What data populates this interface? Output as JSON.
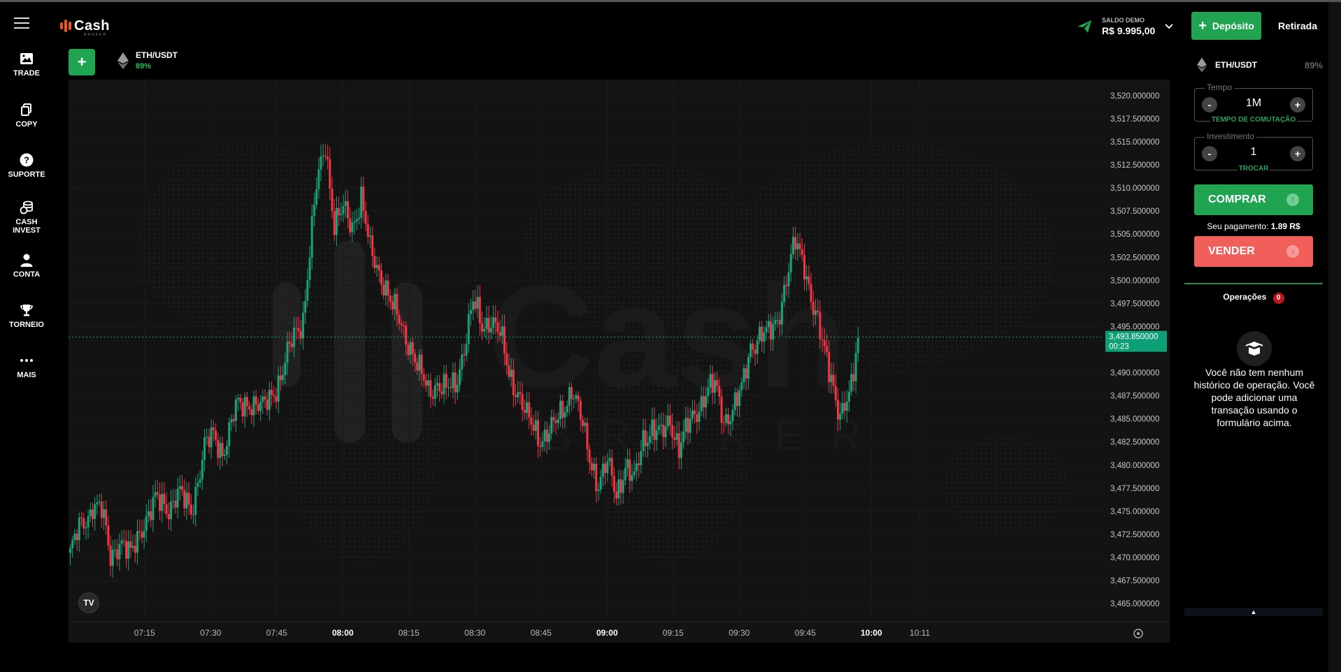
{
  "app": {
    "logo_text": "Cash",
    "logo_sub": "BROKER"
  },
  "sidebar": {
    "items": [
      {
        "label": "TRADE",
        "icon": "image-icon"
      },
      {
        "label": "COPY",
        "icon": "copy-icon"
      },
      {
        "label": "SUPORTE",
        "icon": "help-icon"
      },
      {
        "label": "CASH",
        "label2": "INVEST",
        "icon": "coins-icon"
      },
      {
        "label": "CONTA",
        "icon": "user-icon"
      },
      {
        "label": "TORNEIO",
        "icon": "trophy-icon"
      },
      {
        "label": "MAIS",
        "icon": "more-icon"
      }
    ]
  },
  "toolbar": {
    "add_label": "+",
    "more_label": "..."
  },
  "asset_tab": {
    "name": "ETH/USDT",
    "payout": "89%"
  },
  "header": {
    "balance_caption": "SALDO DEMO",
    "balance_value": "R$ 9.995,00",
    "deposit_label": "Depósito",
    "deposit_plus": "+",
    "withdraw_label": "Retirada"
  },
  "chart": {
    "current_price": "3,493.850000",
    "countdown": "00:23",
    "watermark": "Cash",
    "watermark_sub": "BROKER",
    "tv_label": "TV"
  },
  "chart_data": {
    "type": "candlestick",
    "y_ticks": [
      "3,520.000000",
      "3,517.500000",
      "3,515.000000",
      "3,512.500000",
      "3,510.000000",
      "3,507.500000",
      "3,505.000000",
      "3,502.500000",
      "3,500.000000",
      "3,497.500000",
      "3,495.000000",
      "3,490.000000",
      "3,487.500000",
      "3,485.000000",
      "3,482.500000",
      "3,480.000000",
      "3,477.500000",
      "3,475.000000",
      "3,472.500000",
      "3,470.000000",
      "3,467.500000",
      "3,465.000000"
    ],
    "ylim": [
      3463.5,
      3521.5
    ],
    "x_ticks": [
      {
        "label": "07:15",
        "t": 0.56
      },
      {
        "label": "07:30",
        "t": 1.46
      },
      {
        "label": "07:45",
        "t": 2.36
      },
      {
        "label": "08:00",
        "t": 3.26,
        "bold": true
      },
      {
        "label": "08:15",
        "t": 4.16
      },
      {
        "label": "08:30",
        "t": 5.06
      },
      {
        "label": "08:45",
        "t": 5.96
      },
      {
        "label": "09:00",
        "t": 6.86,
        "bold": true
      },
      {
        "label": "09:15",
        "t": 7.76
      },
      {
        "label": "09:30",
        "t": 8.66
      },
      {
        "label": "09:45",
        "t": 9.56
      },
      {
        "label": "10:00",
        "t": 10.46,
        "bold": true
      },
      {
        "label": "10:11",
        "t": 11.12
      }
    ],
    "up_color": "#1aa37a",
    "down_color": "#f23645",
    "anchors": [
      [
        0,
        3470.5
      ],
      [
        4,
        3473
      ],
      [
        8,
        3474.5
      ],
      [
        10,
        3476
      ],
      [
        14,
        3475
      ],
      [
        18,
        3470
      ],
      [
        22,
        3472
      ],
      [
        27,
        3470
      ],
      [
        32,
        3473.5
      ],
      [
        38,
        3476
      ],
      [
        44,
        3475.5
      ],
      [
        48,
        3477
      ],
      [
        54,
        3475
      ],
      [
        60,
        3482
      ],
      [
        64,
        3483
      ],
      [
        68,
        3481.5
      ],
      [
        74,
        3486
      ],
      [
        80,
        3487
      ],
      [
        86,
        3486
      ],
      [
        94,
        3489.5
      ],
      [
        100,
        3494
      ],
      [
        104,
        3496
      ],
      [
        110,
        3510
      ],
      [
        114,
        3515
      ],
      [
        118,
        3506
      ],
      [
        122,
        3507.5
      ],
      [
        126,
        3506
      ],
      [
        130,
        3509
      ],
      [
        134,
        3503
      ],
      [
        140,
        3500
      ],
      [
        144,
        3497
      ],
      [
        148,
        3495
      ],
      [
        152,
        3493
      ],
      [
        156,
        3490
      ],
      [
        160,
        3488
      ],
      [
        164,
        3489
      ],
      [
        168,
        3488
      ],
      [
        172,
        3488.5
      ],
      [
        176,
        3493
      ],
      [
        180,
        3497.5
      ],
      [
        184,
        3495
      ],
      [
        188,
        3496
      ],
      [
        192,
        3494
      ],
      [
        196,
        3490
      ],
      [
        200,
        3488
      ],
      [
        204,
        3485
      ],
      [
        210,
        3483
      ],
      [
        216,
        3484
      ],
      [
        220,
        3486
      ],
      [
        224,
        3488.5
      ],
      [
        228,
        3485
      ],
      [
        232,
        3481
      ],
      [
        236,
        3478
      ],
      [
        240,
        3480
      ],
      [
        244,
        3477
      ],
      [
        248,
        3480
      ],
      [
        252,
        3478
      ],
      [
        256,
        3483
      ],
      [
        260,
        3484
      ],
      [
        264,
        3483
      ],
      [
        268,
        3485
      ],
      [
        272,
        3482
      ],
      [
        276,
        3484
      ],
      [
        280,
        3486
      ],
      [
        284,
        3488
      ],
      [
        288,
        3488.5
      ],
      [
        292,
        3485
      ],
      [
        296,
        3486
      ],
      [
        300,
        3488
      ],
      [
        304,
        3493
      ],
      [
        308,
        3494
      ],
      [
        312,
        3494
      ],
      [
        316,
        3496
      ],
      [
        320,
        3500
      ],
      [
        324,
        3504
      ],
      [
        328,
        3502
      ],
      [
        332,
        3497
      ],
      [
        336,
        3493
      ],
      [
        340,
        3490
      ],
      [
        344,
        3485
      ],
      [
        348,
        3487
      ],
      [
        352,
        3494
      ]
    ],
    "total_candles": 353
  },
  "panel": {
    "asset_name": "ETH/USDT",
    "asset_payout": "89%",
    "time_legend": "Tempo",
    "time_value": "1M",
    "time_sub": "TEMPO DE COMUTAÇÃO",
    "invest_legend": "Investimento",
    "invest_value": "1",
    "invest_sub": "TROCAR",
    "minus": "-",
    "plus": "+",
    "buy_label": "COMPRAR",
    "sell_label": "VENDER",
    "payout_label": "Seu pagamento:",
    "payout_value": "1.89 R$",
    "ops_label": "Operações",
    "ops_count": "0",
    "empty_text": "Você não tem nenhum histórico de operação. Você pode adicionar uma transação usando o formulário acima.",
    "bottom_arrow": "▲"
  },
  "colors": {
    "accent_green": "#21a452",
    "sell_red": "#f15f5b",
    "price_tag": "#0e9f77"
  }
}
